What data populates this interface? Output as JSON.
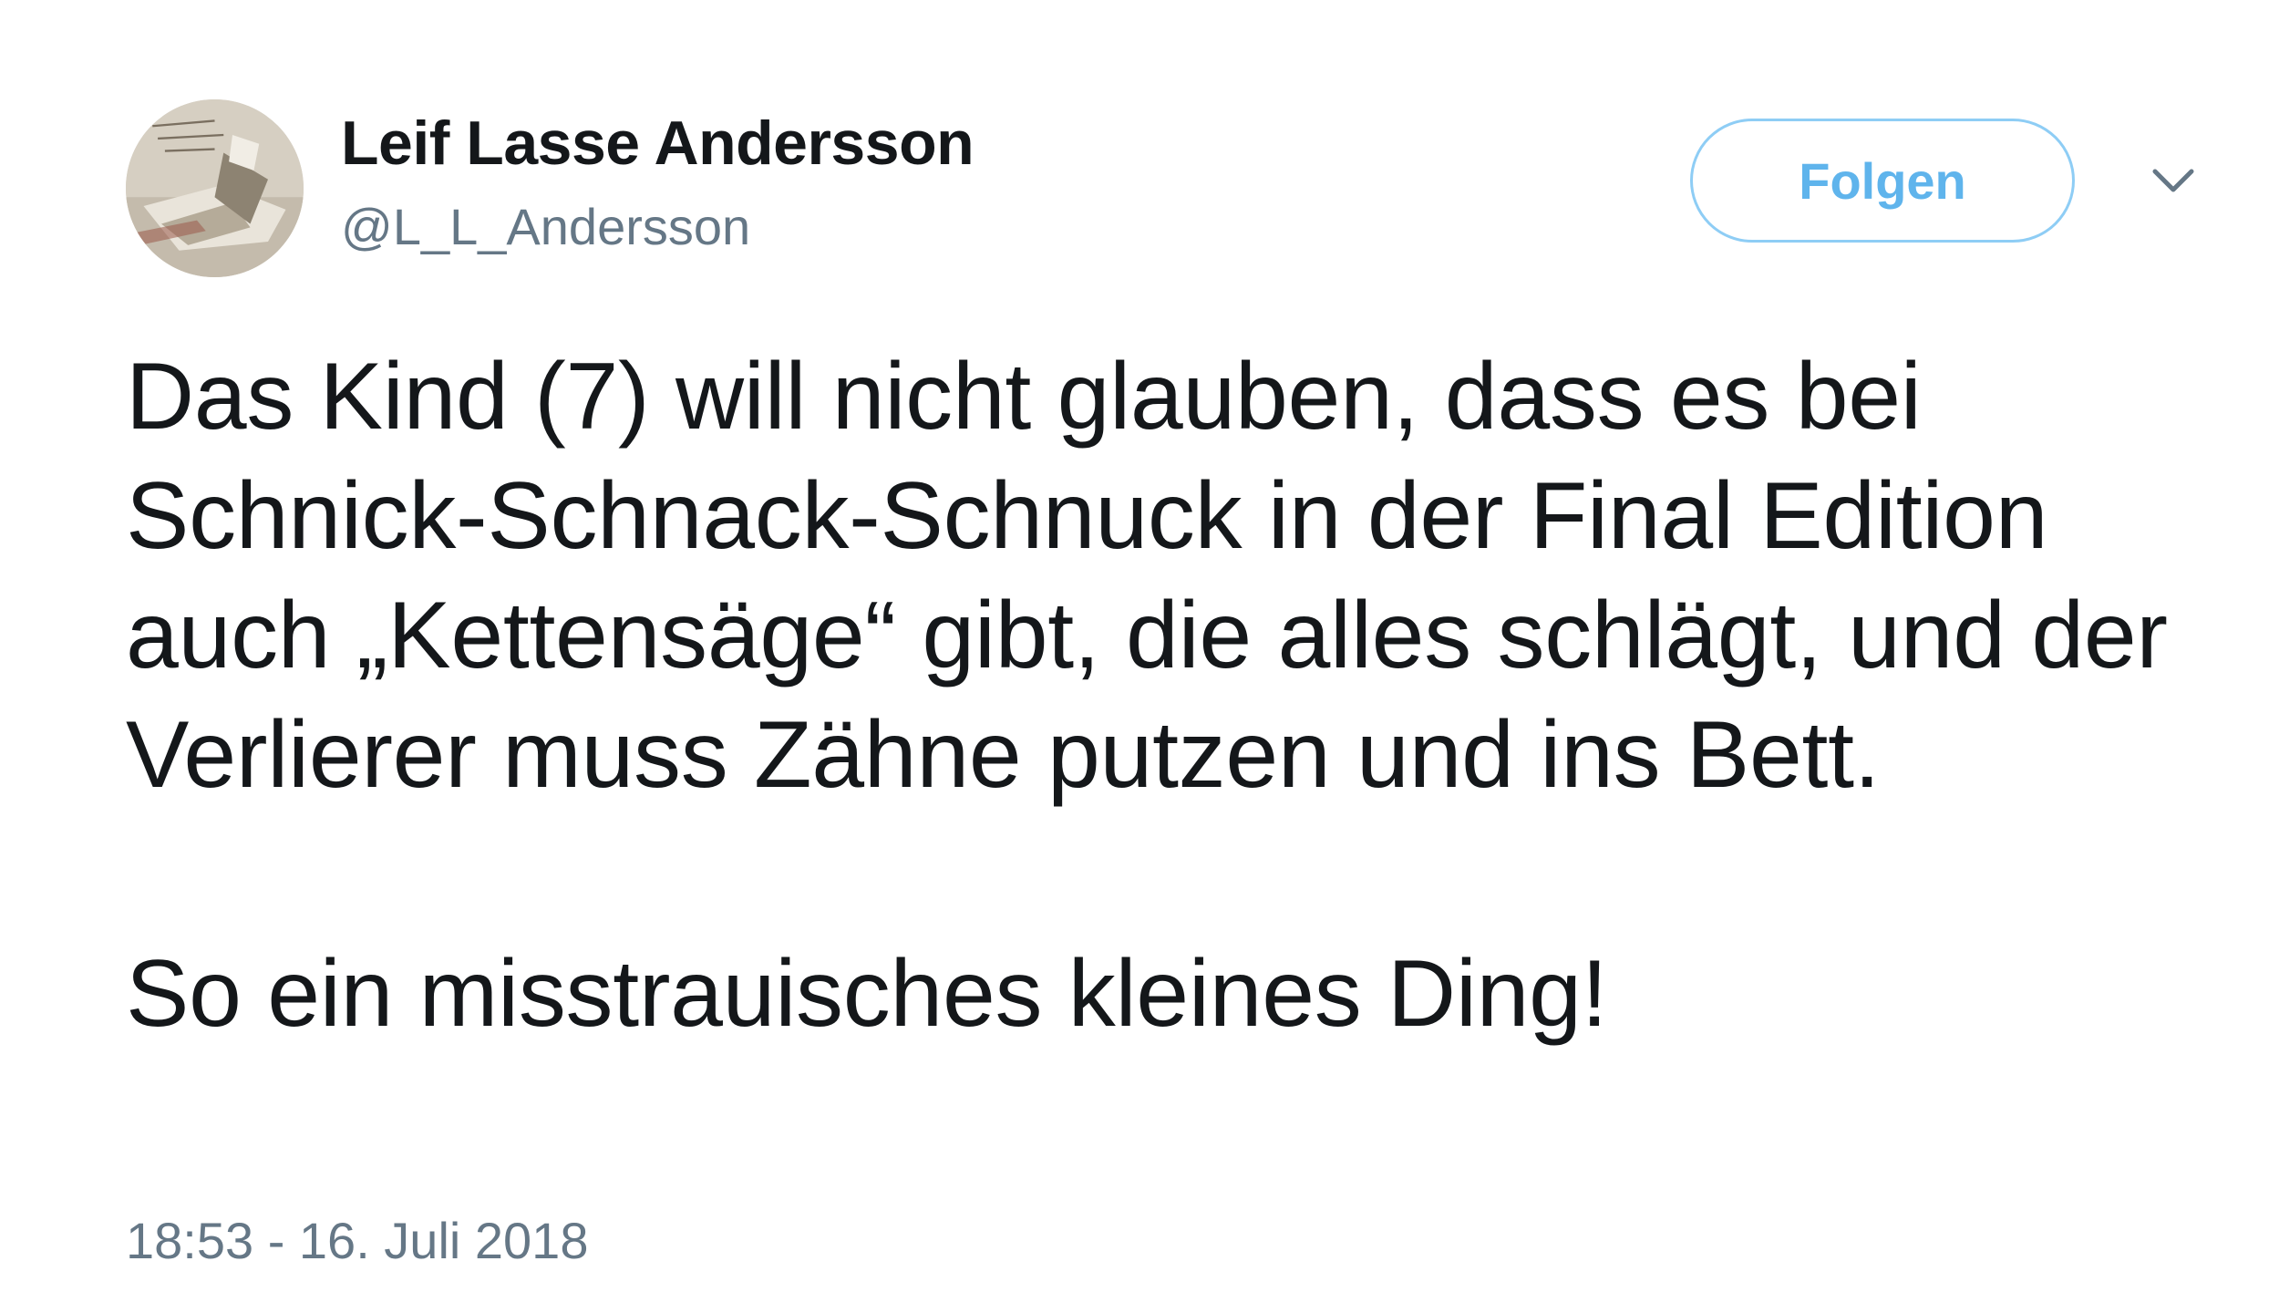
{
  "user": {
    "display_name": "Leif Lasse Andersson",
    "handle": "@L_L_Andersson",
    "avatar_icon": "profile-photo"
  },
  "actions": {
    "follow_label": "Folgen",
    "menu_icon": "chevron-down-icon"
  },
  "tweet": {
    "paragraph_1": "Das Kind (7) will nicht glauben, dass es bei Schnick-Schnack-Schnuck in der Final Edition auch „Kettensäge“ gibt, die alles schlägt, und der Verlierer muss Zähne putzen und ins Bett.",
    "paragraph_2": "So ein misstrauisches kleines Ding!",
    "timestamp": "18:53 - 16. Juli 2018"
  },
  "colors": {
    "text": "#14171a",
    "secondary_text": "#657786",
    "follow_border": "#8ecdf5",
    "follow_text": "#5fb4ec"
  }
}
